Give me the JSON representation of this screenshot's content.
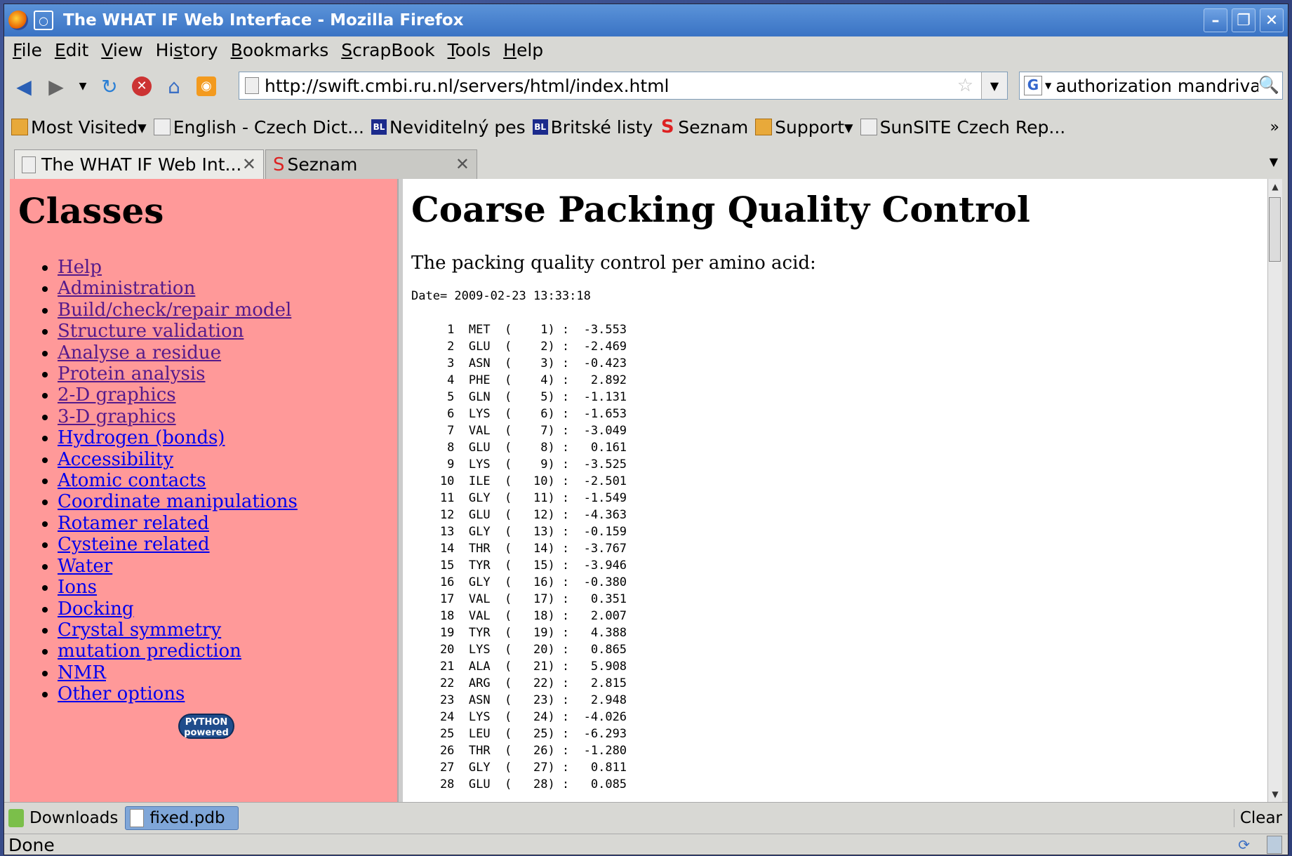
{
  "window": {
    "title": "The WHAT IF Web Interface - Mozilla Firefox"
  },
  "menu": [
    "File",
    "Edit",
    "View",
    "History",
    "Bookmarks",
    "ScrapBook",
    "Tools",
    "Help"
  ],
  "menu_accesskeys": [
    "F",
    "E",
    "V",
    "s",
    "B",
    "S",
    "T",
    "H"
  ],
  "nav": {
    "url": "http://swift.cmbi.ru.nl/servers/html/index.html",
    "search": "authorization mandriva"
  },
  "bookmarks": [
    {
      "label": "Most Visited",
      "dropdown": true,
      "icon": "folder-icon"
    },
    {
      "label": "English - Czech Dict...",
      "dropdown": false,
      "icon": "page-icon"
    },
    {
      "label": "Neviditelný pes",
      "dropdown": false,
      "icon": "bl-icon"
    },
    {
      "label": "Britské listy",
      "dropdown": false,
      "icon": "bl-icon"
    },
    {
      "label": "Seznam",
      "dropdown": false,
      "icon": "seznam-icon"
    },
    {
      "label": "Support",
      "dropdown": true,
      "icon": "folder-icon"
    },
    {
      "label": "SunSITE Czech Rep...",
      "dropdown": false,
      "icon": "page-icon"
    }
  ],
  "tabs": [
    {
      "label": "The WHAT IF Web Int...",
      "active": true
    },
    {
      "label": "Seznam",
      "active": false
    }
  ],
  "sidebar": {
    "title": "Classes",
    "items": [
      "Help",
      "Administration",
      "Build/check/repair model",
      "Structure validation",
      "Analyse a residue",
      "Protein analysis",
      "2-D graphics",
      "3-D graphics",
      "Hydrogen (bonds)",
      "Accessibility",
      "Atomic contacts",
      "Coordinate manipulations",
      "Rotamer related",
      "Cysteine related",
      "Water",
      "Ions",
      "Docking",
      "Crystal symmetry",
      "mutation prediction",
      "NMR",
      "Other options"
    ],
    "visited_count": 8,
    "badge": "PYTHON\npowered"
  },
  "main": {
    "title": "Coarse Packing Quality Control",
    "intro": "The packing quality control per amino acid:",
    "date": "Date= 2009-02-23 13:33:18",
    "rows": [
      {
        "n": 1,
        "res": "MET",
        "num": 1,
        "val": "-3.553"
      },
      {
        "n": 2,
        "res": "GLU",
        "num": 2,
        "val": "-2.469"
      },
      {
        "n": 3,
        "res": "ASN",
        "num": 3,
        "val": "-0.423"
      },
      {
        "n": 4,
        "res": "PHE",
        "num": 4,
        "val": "2.892"
      },
      {
        "n": 5,
        "res": "GLN",
        "num": 5,
        "val": "-1.131"
      },
      {
        "n": 6,
        "res": "LYS",
        "num": 6,
        "val": "-1.653"
      },
      {
        "n": 7,
        "res": "VAL",
        "num": 7,
        "val": "-3.049"
      },
      {
        "n": 8,
        "res": "GLU",
        "num": 8,
        "val": "0.161"
      },
      {
        "n": 9,
        "res": "LYS",
        "num": 9,
        "val": "-3.525"
      },
      {
        "n": 10,
        "res": "ILE",
        "num": 10,
        "val": "-2.501"
      },
      {
        "n": 11,
        "res": "GLY",
        "num": 11,
        "val": "-1.549"
      },
      {
        "n": 12,
        "res": "GLU",
        "num": 12,
        "val": "-4.363"
      },
      {
        "n": 13,
        "res": "GLY",
        "num": 13,
        "val": "-0.159"
      },
      {
        "n": 14,
        "res": "THR",
        "num": 14,
        "val": "-3.767"
      },
      {
        "n": 15,
        "res": "TYR",
        "num": 15,
        "val": "-3.946"
      },
      {
        "n": 16,
        "res": "GLY",
        "num": 16,
        "val": "-0.380"
      },
      {
        "n": 17,
        "res": "VAL",
        "num": 17,
        "val": "0.351"
      },
      {
        "n": 18,
        "res": "VAL",
        "num": 18,
        "val": "2.007"
      },
      {
        "n": 19,
        "res": "TYR",
        "num": 19,
        "val": "4.388"
      },
      {
        "n": 20,
        "res": "LYS",
        "num": 20,
        "val": "0.865"
      },
      {
        "n": 21,
        "res": "ALA",
        "num": 21,
        "val": "5.908"
      },
      {
        "n": 22,
        "res": "ARG",
        "num": 22,
        "val": "2.815"
      },
      {
        "n": 23,
        "res": "ASN",
        "num": 23,
        "val": "2.948"
      },
      {
        "n": 24,
        "res": "LYS",
        "num": 24,
        "val": "-4.026"
      },
      {
        "n": 25,
        "res": "LEU",
        "num": 25,
        "val": "-6.293"
      },
      {
        "n": 26,
        "res": "THR",
        "num": 26,
        "val": "-1.280"
      },
      {
        "n": 27,
        "res": "GLY",
        "num": 27,
        "val": "0.811"
      },
      {
        "n": 28,
        "res": "GLU",
        "num": 28,
        "val": "0.085"
      }
    ]
  },
  "downloads": {
    "label": "Downloads",
    "file": "fixed.pdb",
    "clear": "Clear"
  },
  "status": {
    "text": "Done"
  },
  "colors": {
    "sidebar_bg": "#ff9999",
    "link": "#0000ee",
    "visited": "#551a8b",
    "titlebar": "#3a73c4"
  }
}
